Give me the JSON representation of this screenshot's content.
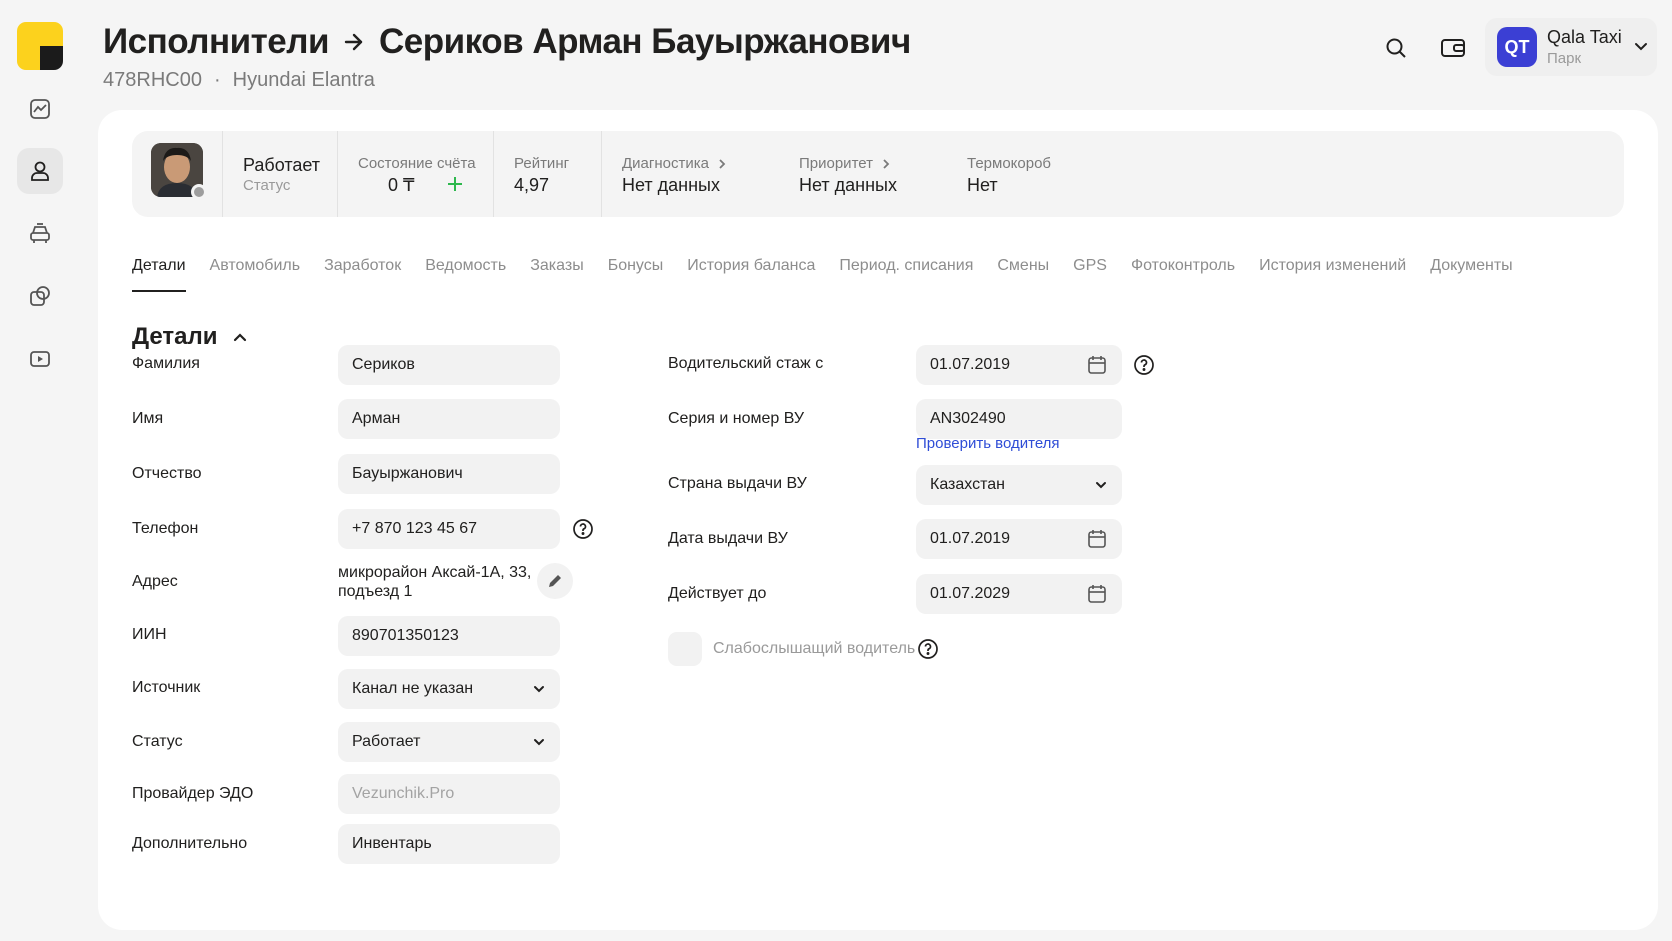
{
  "header": {
    "breadcrumb_root": "Исполнители",
    "driver_name": "Сериков Арман Бауыржанович",
    "plate": "478RHC00",
    "separator": "·",
    "car": "Hyundai Elantra"
  },
  "park": {
    "initials": "QT",
    "name": "Qala Taxi",
    "role": "Парк"
  },
  "stats": {
    "status_value": "Работает",
    "status_label": "Статус",
    "balance_label": "Состояние счёта",
    "balance_value": "0 ₸",
    "rating_label": "Рейтинг",
    "rating_value": "4,97",
    "diagnostics_label": "Диагностика",
    "diagnostics_value": "Нет данных",
    "priority_label": "Приоритет",
    "priority_value": "Нет данных",
    "thermobox_label": "Термокороб",
    "thermobox_value": "Нет"
  },
  "tabs": [
    {
      "label": "Детали",
      "active": true
    },
    {
      "label": "Автомобиль"
    },
    {
      "label": "Заработок"
    },
    {
      "label": "Ведомость"
    },
    {
      "label": "Заказы"
    },
    {
      "label": "Бонусы"
    },
    {
      "label": "История баланса"
    },
    {
      "label": "Период. списания"
    },
    {
      "label": "Смены"
    },
    {
      "label": "GPS"
    },
    {
      "label": "Фотоконтроль"
    },
    {
      "label": "История изменений"
    },
    {
      "label": "Документы"
    }
  ],
  "details": {
    "title": "Детали",
    "left": {
      "last_name_label": "Фамилия",
      "last_name": "Сериков",
      "first_name_label": "Имя",
      "first_name": "Арман",
      "patronymic_label": "Отчество",
      "patronymic": "Бауыржанович",
      "phone_label": "Телефон",
      "phone": "+7 870 123 45 67",
      "address_label": "Адрес",
      "address_line1": "микрорайон Аксай-1А, 33,",
      "address_line2": "подъезд 1",
      "iin_label": "ИИН",
      "iin": "890701350123",
      "source_label": "Источник",
      "source": "Канал не указан",
      "status_label": "Статус",
      "status": "Работает",
      "edo_label": "Провайдер ЭДО",
      "edo_placeholder": "Vezunchik.Pro",
      "extra_label": "Дополнительно",
      "extra": "Инвентарь"
    },
    "right": {
      "experience_label": "Водительский стаж с",
      "experience": "01.07.2019",
      "license_label": "Серия и номер ВУ",
      "license": "AN302490",
      "check_driver_link": "Проверить водителя",
      "country_label": "Страна выдачи ВУ",
      "country": "Казахстан",
      "issue_date_label": "Дата выдачи ВУ",
      "issue_date": "01.07.2019",
      "valid_until_label": "Действует до",
      "valid_until": "01.07.2029",
      "hearing_impaired_label": "Слабослышащий водитель"
    }
  },
  "colors": {
    "accent_yellow": "#fcd21d",
    "park_avatar": "#3b3fd4",
    "link": "#2f4dd6",
    "plus": "#2db84d"
  }
}
